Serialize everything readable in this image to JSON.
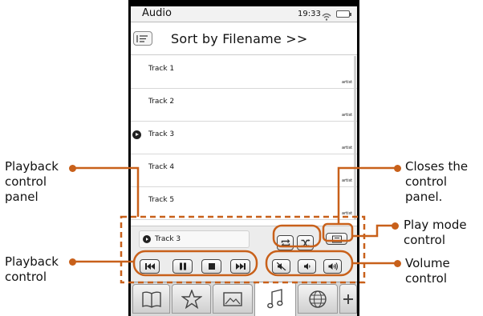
{
  "status_bar": {
    "app_title": "Audio",
    "clock": "19:33"
  },
  "sort_bar": {
    "label": "Sort by Filename >>"
  },
  "tracks": [
    {
      "title": "Track 1",
      "artist": "artist",
      "playing": false
    },
    {
      "title": "Track 2",
      "artist": "artist",
      "playing": false
    },
    {
      "title": "Track 3",
      "artist": "artist",
      "playing": true
    },
    {
      "title": "Track 4",
      "artist": "artist",
      "playing": false
    },
    {
      "title": "Track 5",
      "artist": "artist",
      "playing": false
    }
  ],
  "control_panel": {
    "now_playing": "Track 3"
  },
  "callouts": {
    "playback_panel": [
      "Playback",
      "control",
      "panel"
    ],
    "playback_control": [
      "Playback",
      "control"
    ],
    "closes_panel": [
      "Closes the",
      "control",
      "panel."
    ],
    "play_mode": [
      "Play mode",
      "control"
    ],
    "volume": [
      "Volume",
      "control"
    ]
  },
  "colors": {
    "callout": "#c8601a",
    "frame": "#000000"
  }
}
